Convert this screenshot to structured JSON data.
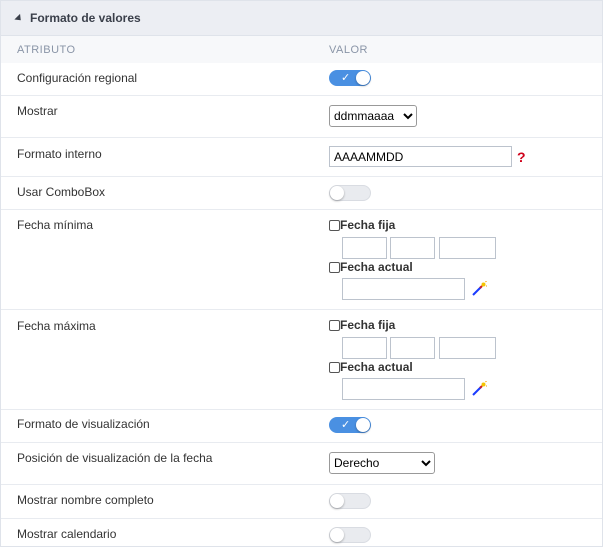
{
  "panel": {
    "title": "Formato de valores"
  },
  "columns": {
    "attribute": "ATRIBUTO",
    "value": "VALOR"
  },
  "rows": {
    "regional": {
      "label": "Configuración regional",
      "toggle": "on"
    },
    "mostrar": {
      "label": "Mostrar",
      "selected": "ddmmaaaa"
    },
    "formato_interno": {
      "label": "Formato interno",
      "value": "AAAAMMDD",
      "help": "?"
    },
    "combobox": {
      "label": "Usar ComboBox",
      "toggle": "off"
    },
    "fecha_min": {
      "label": "Fecha mínima",
      "fixed": "Fecha fija",
      "current": "Fecha actual"
    },
    "fecha_max": {
      "label": "Fecha máxima",
      "fixed": "Fecha fija",
      "current": "Fecha actual"
    },
    "visualizacion": {
      "label": "Formato de visualización",
      "toggle": "on"
    },
    "posicion": {
      "label": "Posición de visualización de la fecha",
      "selected": "Derecho"
    },
    "nombre_completo": {
      "label": "Mostrar nombre completo",
      "toggle": "off"
    },
    "calendario": {
      "label": "Mostrar calendario",
      "toggle": "off"
    }
  },
  "colors": {
    "accent": "#4a90e2",
    "help": "#d0021b",
    "header_bg": "#eceef3"
  },
  "icons": {
    "toggle_check": "✓",
    "wand": "magic-wand-icon",
    "collapse": "triangle-down-icon"
  }
}
